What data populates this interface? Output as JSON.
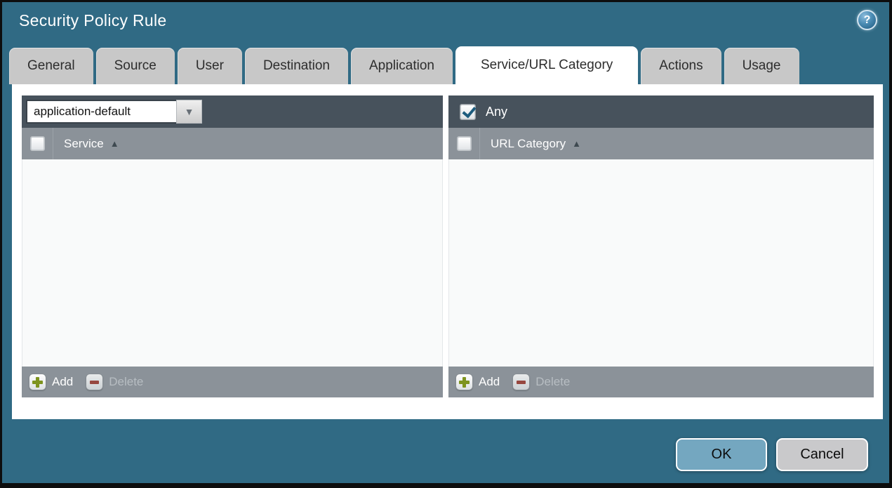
{
  "window": {
    "title": "Security Policy Rule",
    "help_glyph": "?"
  },
  "glyphs": {
    "dropdown_arrow": "▼",
    "sort_ascending": "▲"
  },
  "tabs": [
    {
      "label": "General",
      "active": false
    },
    {
      "label": "Source",
      "active": false
    },
    {
      "label": "User",
      "active": false
    },
    {
      "label": "Destination",
      "active": false
    },
    {
      "label": "Application",
      "active": false
    },
    {
      "label": "Service/URL Category",
      "active": true
    },
    {
      "label": "Actions",
      "active": false
    },
    {
      "label": "Usage",
      "active": false
    }
  ],
  "service_panel": {
    "dropdown_value": "application-default",
    "header": "Service",
    "header_checkbox_checked": false,
    "rows": [],
    "add_label": "Add",
    "delete_label": "Delete",
    "delete_enabled": false
  },
  "url_category_panel": {
    "any_label": "Any",
    "any_checked": true,
    "header": "URL Category",
    "header_checkbox_checked": false,
    "rows": [],
    "add_label": "Add",
    "delete_label": "Delete",
    "delete_enabled": false
  },
  "dialog_buttons": {
    "ok": "OK",
    "cancel": "Cancel"
  },
  "colors": {
    "background": "#306a84",
    "titlebar_text": "#ffffff",
    "tab_inactive": "#c8c8c8",
    "tab_active": "#ffffff",
    "panel_toolbar": "#47525c",
    "panel_header_footer": "#8b9299",
    "panel_body": "#f9fafa",
    "add_icon_green": "#7e941f",
    "delete_icon_red": "#97473f",
    "checkmark_blue": "#1d5c7e",
    "ok_button": "#74a7c0",
    "cancel_button": "#c9c9cb"
  }
}
